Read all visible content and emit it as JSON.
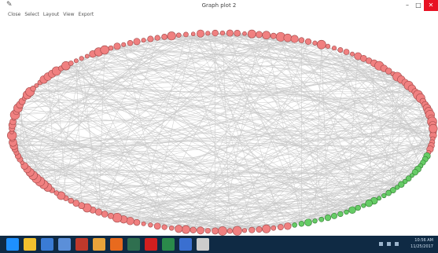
{
  "window": {
    "title": "Graph plot 2",
    "app_icon": "feather-icon",
    "controls": [
      "–",
      "□",
      "✕"
    ]
  },
  "menu": [
    "Close",
    "Select",
    "Layout",
    "View",
    "Export"
  ],
  "graph": {
    "layout": "circular",
    "node_colors": {
      "default": "#f08080",
      "highlighted": "#66cc66"
    },
    "edge_color": "#c8c8c8",
    "label_color": "#2020c0"
  },
  "taskbar": {
    "apps": [
      "windows-start-icon",
      "file-explorer-icon",
      "help-icon",
      "app-icon",
      "matlab-icon",
      "chrome-icon",
      "firefox-icon",
      "calculator-icon",
      "pdf-icon",
      "excel-icon",
      "paint-icon",
      "feather-icon"
    ],
    "time": "10:56 AM",
    "date": "11/25/2017"
  }
}
